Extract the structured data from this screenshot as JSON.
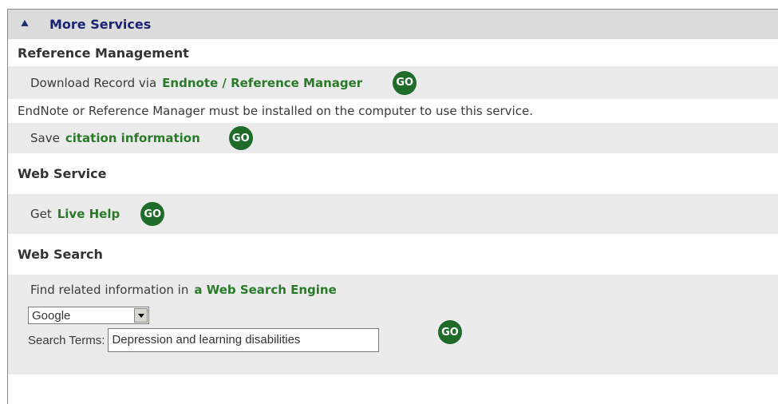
{
  "header": {
    "title": "More Services",
    "icon": "double-chevron-up-icon"
  },
  "reference_management": {
    "title": "Reference Management",
    "download_prefix": "Download Record via",
    "download_link": "Endnote / Reference Manager",
    "note": "EndNote or Reference Manager must be installed on the computer to use this service.",
    "save_prefix": "Save",
    "save_link": "citation information"
  },
  "web_service": {
    "title": "Web Service",
    "help_prefix": "Get",
    "help_link": "Live Help"
  },
  "web_search": {
    "title": "Web Search",
    "find_prefix": "Find related information in",
    "find_link": "a Web Search Engine",
    "engine_selected": "Google",
    "search_terms_label": "Search Terms:",
    "search_terms_value": "Depression and learning disabilities"
  },
  "go_label": "GO",
  "colors": {
    "header_bg": "#dcdcdc",
    "band_bg": "#ebebeb",
    "link": "#2a7a2a",
    "go_button": "#1f6b2a",
    "title": "#1a2374"
  }
}
